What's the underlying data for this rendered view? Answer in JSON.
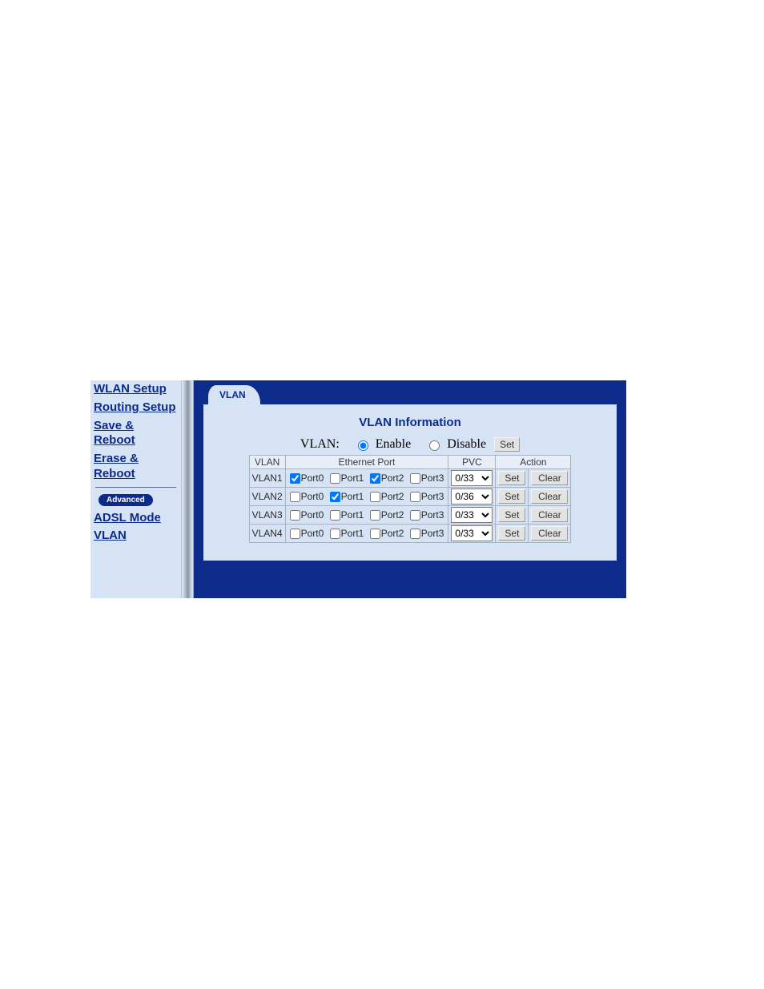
{
  "sidebar": {
    "items": [
      {
        "label": "WLAN Setup"
      },
      {
        "label": "Routing Setup"
      },
      {
        "label": "Save & Reboot"
      },
      {
        "label": "Erase & Reboot"
      }
    ],
    "advanced_label": "Advanced",
    "adv_items": [
      {
        "label": "ADSL Mode"
      },
      {
        "label": "VLAN"
      }
    ]
  },
  "tab": {
    "label": "VLAN"
  },
  "panel": {
    "title": "VLAN Information",
    "vlan_label": "VLAN:",
    "enable_label": "Enable",
    "disable_label": "Disable",
    "set_button": "Set",
    "enable_selected": "enable",
    "headers": {
      "vlan": "VLAN",
      "eth": "Ethernet Port",
      "pvc": "PVC",
      "action": "Action"
    },
    "port_labels": [
      "Port0",
      "Port1",
      "Port2",
      "Port3"
    ],
    "row_set": "Set",
    "row_clear": "Clear",
    "rows": [
      {
        "name": "VLAN1",
        "ports": [
          true,
          false,
          true,
          false
        ],
        "pvc": "0/33"
      },
      {
        "name": "VLAN2",
        "ports": [
          false,
          true,
          false,
          false
        ],
        "pvc": "0/36"
      },
      {
        "name": "VLAN3",
        "ports": [
          false,
          false,
          false,
          false
        ],
        "pvc": "0/33"
      },
      {
        "name": "VLAN4",
        "ports": [
          false,
          false,
          false,
          false
        ],
        "pvc": "0/33"
      }
    ]
  }
}
